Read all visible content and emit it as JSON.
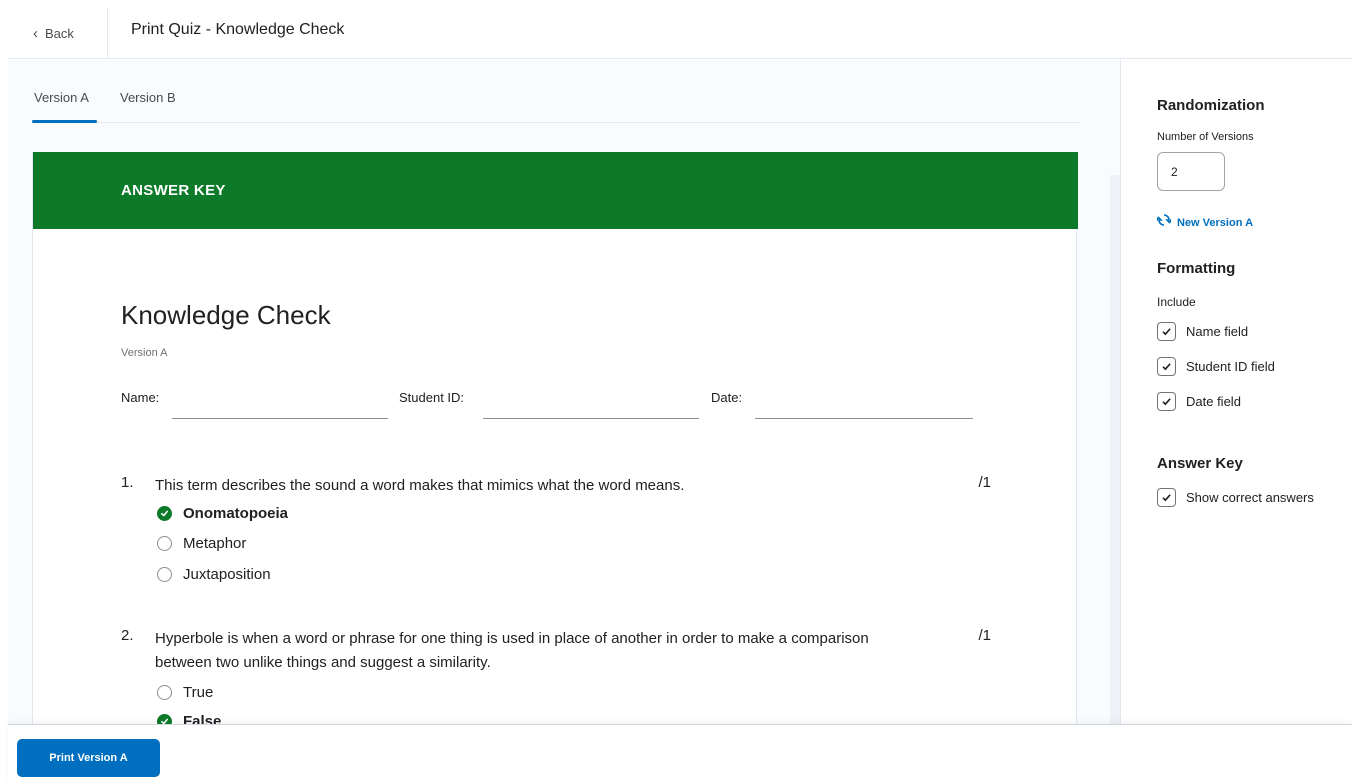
{
  "header": {
    "back_label": "Back",
    "title": "Print Quiz - Knowledge Check"
  },
  "tabs": [
    {
      "label": "Version A",
      "selected": true
    },
    {
      "label": "Version B",
      "selected": false
    }
  ],
  "quiz": {
    "banner": "ANSWER KEY",
    "title": "Knowledge Check",
    "version": "Version A",
    "fields": {
      "name_label": "Name:",
      "student_id_label": "Student ID:",
      "date_label": "Date:"
    },
    "questions": [
      {
        "number": "1.",
        "text": "This term describes the sound a word makes that mimics what the word means.",
        "points": "/1",
        "options": [
          {
            "text": "Onomatopoeia",
            "correct": true
          },
          {
            "text": "Metaphor",
            "correct": false
          },
          {
            "text": "Juxtaposition",
            "correct": false
          }
        ]
      },
      {
        "number": "2.",
        "text": "Hyperbole is when a word or phrase for one thing is used in place of another in order to make a comparison between two unlike things and suggest a similarity.",
        "points": "/1",
        "options": [
          {
            "text": "True",
            "correct": false
          },
          {
            "text": "False",
            "correct": true
          }
        ]
      }
    ]
  },
  "sidebar": {
    "randomization_heading": "Randomization",
    "versions_label": "Number of Versions",
    "versions_value": "2",
    "new_version_link": "New Version A",
    "formatting_heading": "Formatting",
    "include_label": "Include",
    "include_options": [
      {
        "label": "Name field",
        "checked": true
      },
      {
        "label": "Student ID field",
        "checked": true
      },
      {
        "label": "Date field",
        "checked": true
      }
    ],
    "answer_key_heading": "Answer Key",
    "answer_key_option": {
      "label": "Show correct answers",
      "checked": true
    }
  },
  "footer": {
    "print_button": "Print Version A"
  },
  "colors": {
    "banner_green": "#0c7a29",
    "primary_blue": "#006fbf",
    "correct_green": "#0c7a29"
  }
}
